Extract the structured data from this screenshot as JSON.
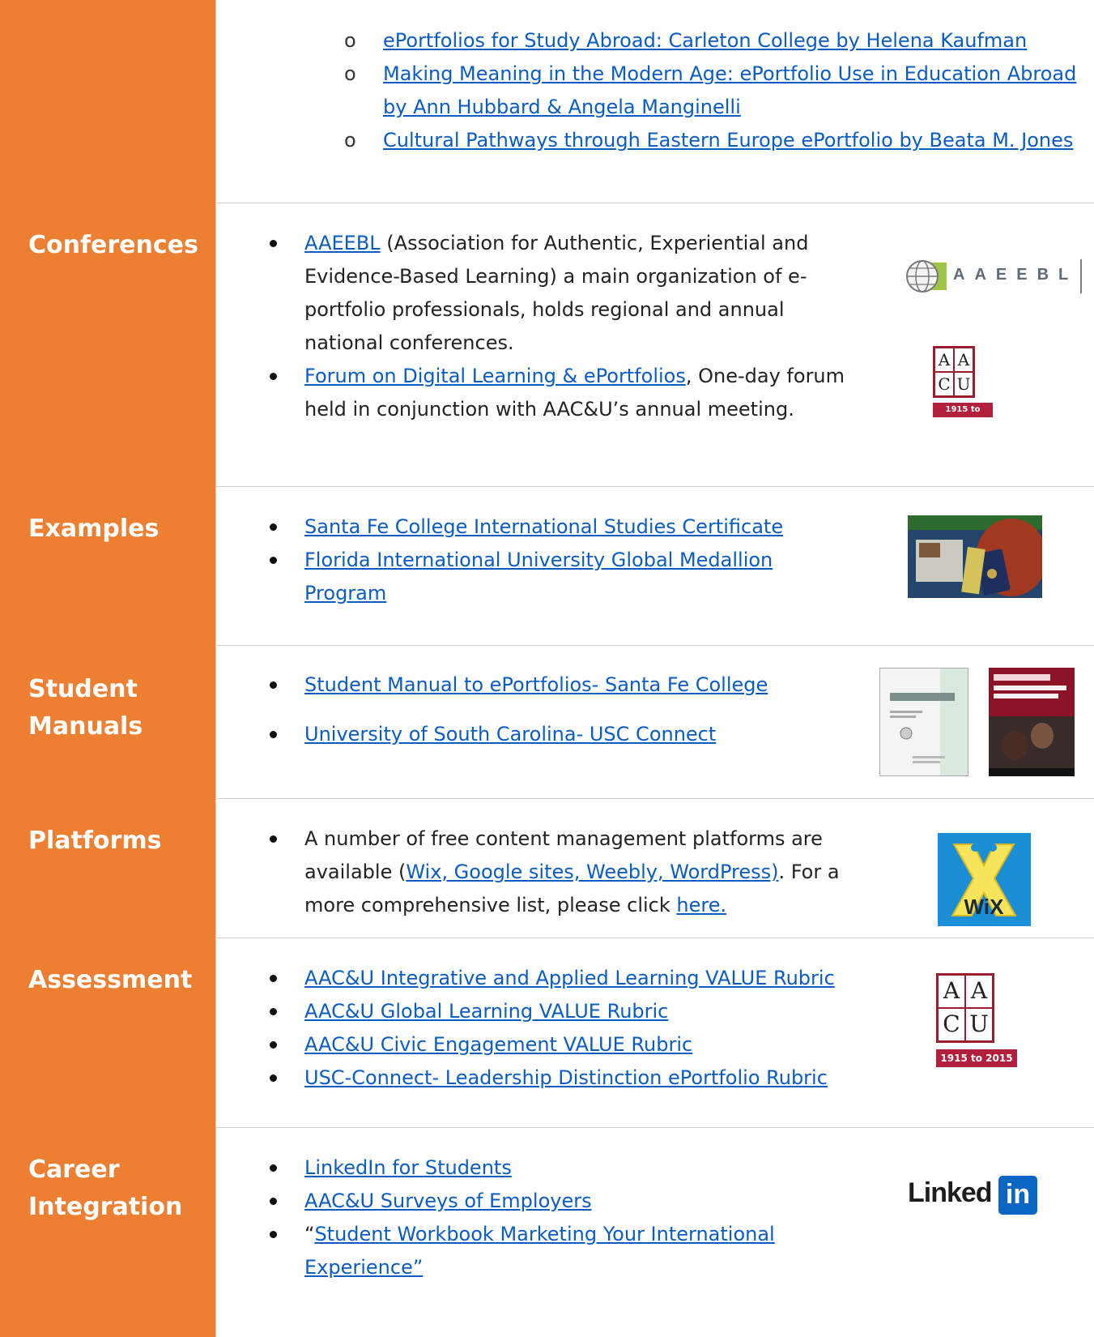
{
  "rows": {
    "study_abroad": {
      "links": [
        [
          "ePortfolios for Study Abroad: Carleton College by Helena Kaufman"
        ],
        [
          "Making Meaning in the Modern Age: ePortfolio Use in Education Abroad",
          "by Ann Hubbard & Angela Manginelli"
        ],
        [
          "Cultural Pathways through Eastern Europe ePortfolio by Beata M. Jones"
        ]
      ],
      "bullet": "o"
    },
    "conferences": {
      "label": "Conferences",
      "item1": {
        "link": "AAEEBL",
        "line1": " (Association for Authentic, Experiential and",
        "line2": "Evidence-Based Learning) a main organization of e-",
        "line3": "portfolio professionals, holds regional and annual",
        "line4": "national conferences."
      },
      "item2": {
        "link": "Forum on Digital Learning & ePortfolios",
        "line1": ", One-day forum",
        "line2": "held in conjunction with AAC&U’s annual meeting."
      },
      "aaeebl_logo_text": "AAEEBL"
    },
    "examples": {
      "label": "Examples",
      "items": [
        [
          "Santa Fe College International Studies Certificate "
        ],
        [
          "Florida International University Global Medallion",
          "Program"
        ]
      ]
    },
    "student_manuals": {
      "label": "Student Manuals",
      "items": [
        " Student Manual to ePortfolios- Santa Fe College ",
        "University of South Carolina- USC Connect"
      ]
    },
    "platforms": {
      "label": "Platforms",
      "line1": "A number of free content management platforms are",
      "line2_pre": "available (",
      "line2_link": "Wix, Google sites, Weebly, WordPress)",
      "line2_post": ". For a",
      "line3_pre": "more comprehensive list, please click ",
      "line3_link": "here."
    },
    "assessment": {
      "label": "Assessment",
      "items": [
        "AAC&U Integrative and Applied Learning VALUE Rubric",
        "AAC&U Global Learning VALUE Rubric",
        "AAC&U Civic Engagement VALUE Rubric",
        "USC-Connect- Leadership Distinction ePortfolio Rubric"
      ]
    },
    "career": {
      "label": "Career Integration",
      "items": [
        "LinkedIn for Students",
        "AAC&U Surveys of Employers"
      ],
      "item3_quote": "“",
      "item3_line1": "Student Workbook Marketing Your International",
      "item3_line2": "Experience”",
      "linkedin_text": "Linked",
      "linkedin_in": "in"
    }
  },
  "aacu_logo": {
    "letters": [
      "A",
      "A",
      "C",
      "U"
    ],
    "ribbon": "1915 to 2015"
  },
  "colors": {
    "label_bg": "#ec7f32",
    "link": "#0b5cc2",
    "aacu_red": "#b21f3c",
    "wix_blue": "#1a8fd8",
    "linkedin_blue": "#0a66c2"
  }
}
